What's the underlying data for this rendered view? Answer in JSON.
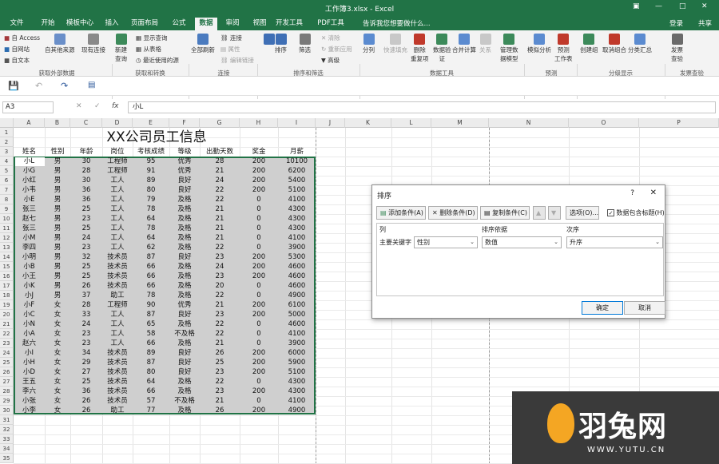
{
  "window": {
    "title": "工作簿3.xlsx - Excel",
    "icons": [
      "ribbon-display-icon",
      "minimize-icon",
      "maximize-icon",
      "close-icon"
    ]
  },
  "tabs": [
    "文件",
    "开始",
    "模板中心",
    "插入",
    "页面布局",
    "公式",
    "数据",
    "审阅",
    "视图",
    "开发工具",
    "PDF工具集"
  ],
  "active_tab": "数据",
  "search_placeholder": "告诉我您想要做什么...",
  "account": {
    "login": "登录",
    "share": "共享"
  },
  "ribbon": {
    "access": "自 Access",
    "web": "自网站",
    "text": "自文本",
    "other": "自其他来源",
    "existing": "现有连接",
    "new_query": "新建\n查询",
    "show_queries": "显示查询",
    "from_table": "从表格",
    "recent_sources": "最近使用的源",
    "refresh_all": "全部刷新",
    "connections": "连接",
    "properties": "属性",
    "edit_links": "编辑链接",
    "sort_az": "A↓Z",
    "sort": "排序",
    "filter": "筛选",
    "clear": "清除",
    "reapply": "重新应用",
    "advanced": "高级",
    "split": "分列",
    "flash_fill": "快速填充",
    "remove_dup": "删除\n重复项",
    "validate": "数据验\n证",
    "consolidate": "合并计算",
    "relations": "关系",
    "data_model": "管理数\n据模型",
    "what_if": "模拟分析",
    "forecast_sheet": "预测\n工作表",
    "group": "创建组",
    "ungroup": "取消组合",
    "subtotal": "分类汇总",
    "publish": "发票\n查验",
    "groups": [
      "获取外部数据",
      "获取和转换",
      "连接",
      "排序和筛选",
      "数据工具",
      "预测",
      "分级显示",
      "发票查验"
    ]
  },
  "namebox": "A3",
  "formula": "小L",
  "columns": [
    "A",
    "B",
    "C",
    "D",
    "E",
    "F",
    "G",
    "H",
    "I",
    "J",
    "K",
    "L",
    "M",
    "N",
    "O",
    "P"
  ],
  "sheet": {
    "title": "XX公司员工信息",
    "headers": [
      "姓名",
      "性别",
      "年龄",
      "岗位",
      "考核成绩",
      "等级",
      "出勤天数",
      "奖金",
      "月薪"
    ],
    "rows": [
      [
        "小L",
        "男",
        "30",
        "工程师",
        "95",
        "优秀",
        "28",
        "200",
        "10100"
      ],
      [
        "小G",
        "男",
        "28",
        "工程师",
        "91",
        "优秀",
        "21",
        "200",
        "6200"
      ],
      [
        "小红",
        "男",
        "30",
        "工人",
        "89",
        "良好",
        "24",
        "200",
        "5400"
      ],
      [
        "小韦",
        "男",
        "36",
        "工人",
        "80",
        "良好",
        "22",
        "200",
        "5100"
      ],
      [
        "小E",
        "男",
        "36",
        "工人",
        "79",
        "及格",
        "22",
        "0",
        "4100"
      ],
      [
        "张三",
        "男",
        "25",
        "工人",
        "78",
        "及格",
        "21",
        "0",
        "4300"
      ],
      [
        "赵七",
        "男",
        "23",
        "工人",
        "64",
        "及格",
        "21",
        "0",
        "4300"
      ],
      [
        "张三",
        "男",
        "25",
        "工人",
        "78",
        "及格",
        "21",
        "0",
        "4300"
      ],
      [
        "小M",
        "男",
        "24",
        "工人",
        "64",
        "及格",
        "21",
        "0",
        "4100"
      ],
      [
        "李四",
        "男",
        "23",
        "工人",
        "62",
        "及格",
        "22",
        "0",
        "3900"
      ],
      [
        "小明",
        "男",
        "32",
        "技术员",
        "87",
        "良好",
        "23",
        "200",
        "5300"
      ],
      [
        "小B",
        "男",
        "25",
        "技术员",
        "66",
        "及格",
        "24",
        "200",
        "4600"
      ],
      [
        "小王",
        "男",
        "25",
        "技术员",
        "66",
        "及格",
        "23",
        "200",
        "4600"
      ],
      [
        "小K",
        "男",
        "26",
        "技术员",
        "66",
        "及格",
        "20",
        "0",
        "4600"
      ],
      [
        "小J",
        "男",
        "37",
        "助工",
        "78",
        "及格",
        "22",
        "0",
        "4900"
      ],
      [
        "小F",
        "女",
        "28",
        "工程师",
        "90",
        "优秀",
        "21",
        "200",
        "6100"
      ],
      [
        "小C",
        "女",
        "33",
        "工人",
        "87",
        "良好",
        "23",
        "200",
        "5000"
      ],
      [
        "小N",
        "女",
        "24",
        "工人",
        "65",
        "及格",
        "22",
        "0",
        "4600"
      ],
      [
        "小A",
        "女",
        "23",
        "工人",
        "58",
        "不及格",
        "22",
        "0",
        "4100"
      ],
      [
        "赵六",
        "女",
        "23",
        "工人",
        "66",
        "及格",
        "21",
        "0",
        "3900"
      ],
      [
        "小I",
        "女",
        "34",
        "技术员",
        "89",
        "良好",
        "26",
        "200",
        "6000"
      ],
      [
        "小H",
        "女",
        "29",
        "技术员",
        "87",
        "良好",
        "25",
        "200",
        "5900"
      ],
      [
        "小D",
        "女",
        "27",
        "技术员",
        "80",
        "良好",
        "23",
        "200",
        "5100"
      ],
      [
        "王五",
        "女",
        "25",
        "技术员",
        "64",
        "及格",
        "22",
        "0",
        "4300"
      ],
      [
        "李六",
        "女",
        "36",
        "技术员",
        "66",
        "及格",
        "23",
        "200",
        "4300"
      ],
      [
        "小张",
        "女",
        "26",
        "技术员",
        "57",
        "不及格",
        "21",
        "0",
        "4100"
      ],
      [
        "小李",
        "女",
        "26",
        "助工",
        "77",
        "及格",
        "26",
        "200",
        "4900"
      ]
    ],
    "row_numbers": [
      "1",
      "2",
      "3",
      "4",
      "5",
      "6",
      "7",
      "8",
      "9",
      "10",
      "11",
      "12",
      "13",
      "14",
      "15",
      "16",
      "17",
      "18",
      "19",
      "20",
      "21",
      "22",
      "23",
      "24",
      "25",
      "26",
      "27",
      "28",
      "29",
      "30",
      "31",
      "32",
      "33",
      "34",
      "35"
    ]
  },
  "dialog": {
    "title": "排序",
    "help": "?",
    "close": "✕",
    "add": "添加条件(A)",
    "delete": "删除条件(D)",
    "copy": "复制条件(C)",
    "options": "选项(O)...",
    "has_header": "数据包含标题(H)",
    "col_header": "列",
    "basis_header": "排序依据",
    "order_header": "次序",
    "key_label": "主要关键字",
    "key_value": "性别",
    "basis_value": "数值",
    "order_value": "升序",
    "ok": "确定",
    "cancel": "取消"
  },
  "watermark": {
    "name": "羽兔网",
    "url": "WWW.YUTU.CN"
  },
  "colors": {
    "excel_green": "#217346",
    "selection": "#cfcfcf"
  }
}
